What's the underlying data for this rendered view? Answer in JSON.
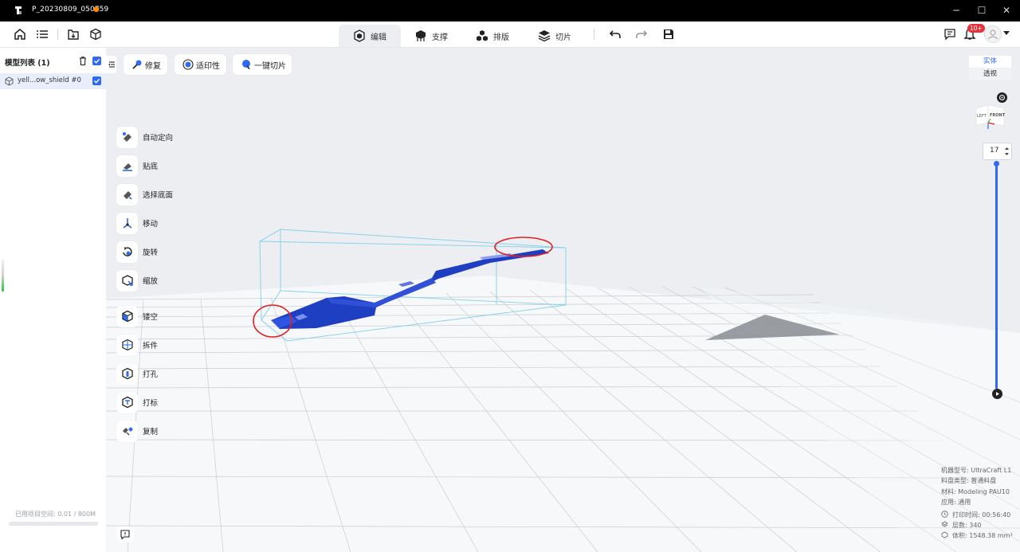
{
  "window": {
    "title": "P_20230809_050759",
    "unsaved_dot": "●",
    "controls": {
      "minimize": "─",
      "maximize": "☐",
      "close": "✕"
    }
  },
  "toolbar": {
    "tabs": [
      {
        "label": "编辑",
        "icon": "edit-cube-icon",
        "active": true
      },
      {
        "label": "支撑",
        "icon": "support-icon",
        "active": false
      },
      {
        "label": "排版",
        "icon": "layout-icon",
        "active": false
      },
      {
        "label": "切片",
        "icon": "slice-layers-icon",
        "active": false
      }
    ],
    "notification_badge": "10+"
  },
  "left_panel": {
    "header": "模型列表 (1)",
    "models": [
      {
        "name": "yell...ow_shield #0",
        "checked": true
      }
    ],
    "space_label": "已用项目空间: 0.01 / 800M",
    "space_used_fraction": 1.25e-05
  },
  "actions": [
    {
      "label": "修复",
      "icon": "repair-icon"
    },
    {
      "label": "适印性",
      "icon": "printability-icon"
    },
    {
      "label": "一键切片",
      "icon": "one-click-slice-icon"
    }
  ],
  "tools": [
    {
      "label": "自动定向",
      "icon": "auto-orient-icon"
    },
    {
      "label": "贴底",
      "icon": "lay-flat-icon"
    },
    {
      "label": "选择底面",
      "icon": "select-bottom-icon"
    },
    {
      "label": "移动",
      "icon": "move-icon"
    },
    {
      "label": "旋转",
      "icon": "rotate-icon"
    },
    {
      "label": "缩放",
      "icon": "scale-icon"
    },
    {
      "label": "镂空",
      "icon": "hollow-icon"
    },
    {
      "label": "拆件",
      "icon": "split-icon"
    },
    {
      "label": "打孔",
      "icon": "punch-icon"
    },
    {
      "label": "打标",
      "icon": "label-icon"
    },
    {
      "label": "复制",
      "icon": "copy-icon"
    }
  ],
  "view": {
    "solid": "实体",
    "perspective": "透视",
    "cube_left": "LEFT",
    "cube_front": "FRONT"
  },
  "layer": {
    "value": "17",
    "level_fraction": 1.0
  },
  "info": {
    "machine": "机器型号:  UltraCraft L1",
    "tray": "料盘类型:  普通料盘",
    "material": "材料:  Modeling PAU10",
    "application": "应用:  通用",
    "print_time": "打印时间: 00:56:40",
    "layers": "层数: 340",
    "volume": "体积: 1548.38 mm³"
  },
  "colors": {
    "accent": "#2f6af0",
    "model": "#1f3fc2",
    "badge": "#e8303a"
  }
}
